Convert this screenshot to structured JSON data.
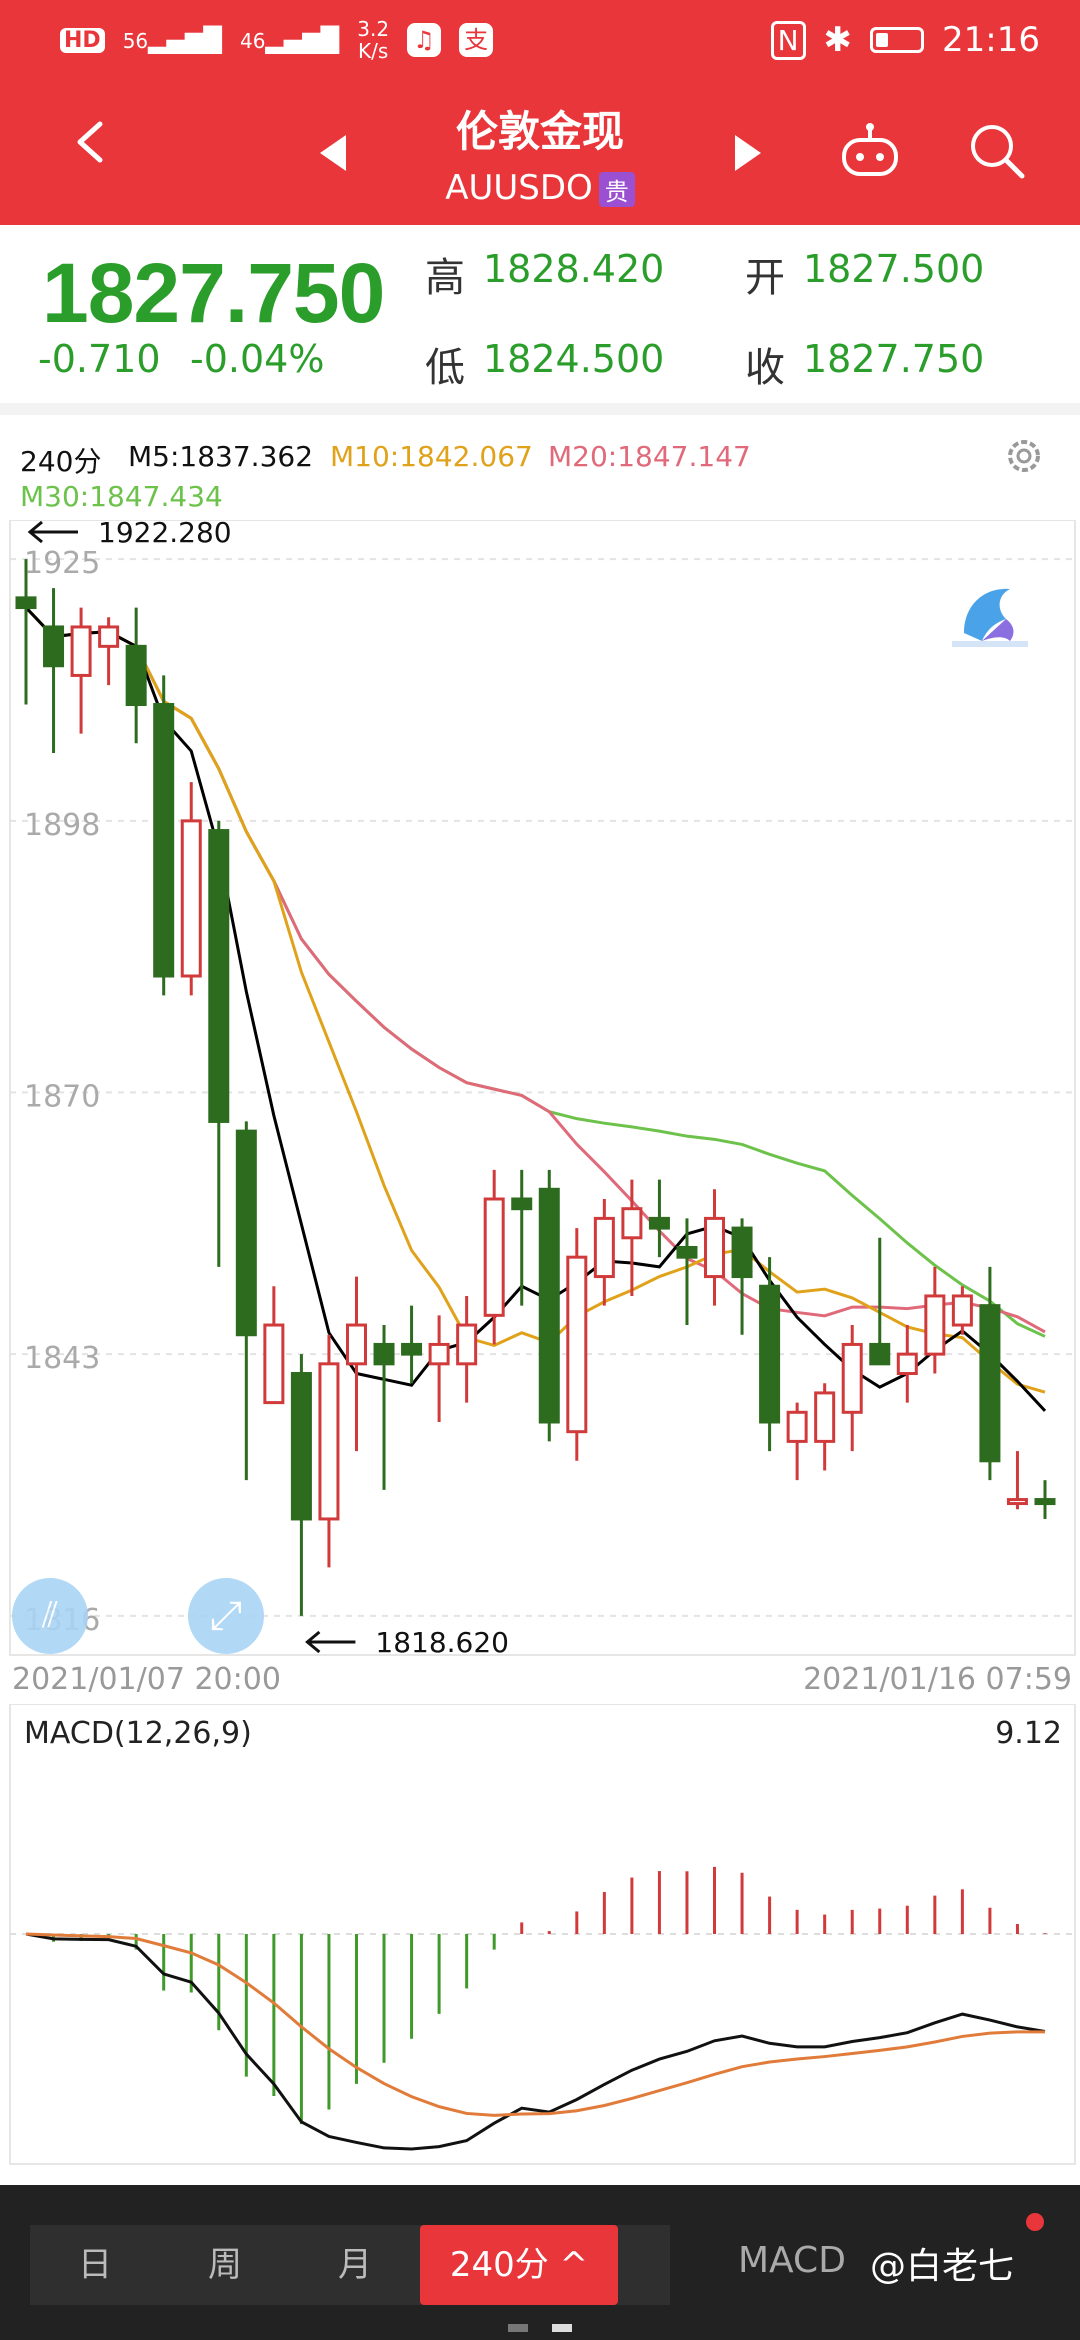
{
  "status_bar": {
    "hd_badge": "HD",
    "sim1": "56",
    "sim2": "46",
    "speed_value": "3.2",
    "speed_unit": "K/s",
    "time": "21:16"
  },
  "header": {
    "title": "伦敦金现",
    "code": "AUUSDO",
    "tag": "贵"
  },
  "quote": {
    "price": "1827.750",
    "change": "-0.710",
    "change_pct": "-0.04%",
    "high_label": "高",
    "high": "1828.420",
    "low_label": "低",
    "low": "1824.500",
    "open_label": "开",
    "open": "1827.500",
    "close_label": "收",
    "close": "1827.750"
  },
  "chart": {
    "period": "240分",
    "ma5": "M5:1837.362",
    "ma10": "M10:1842.067",
    "ma20": "M20:1847.147",
    "ma30": "M30:1847.434",
    "max_label": "1922.280",
    "min_label": "1818.620",
    "y_ticks": [
      "1925",
      "1898",
      "1870",
      "1843",
      "1816"
    ],
    "start_time": "2021/01/07 20:00",
    "end_time": "2021/01/16 07:59",
    "colors": {
      "ma5": "#000000",
      "ma10": "#e0a21a",
      "ma20": "#e0697a",
      "ma30": "#6cc24a",
      "up": "#d03a3a",
      "down": "#2d6b1e"
    }
  },
  "macd": {
    "label": "MACD(12,26,9)",
    "value": "9.12"
  },
  "bottom_bar": {
    "tabs": [
      "日",
      "周",
      "月",
      "240分 ^"
    ],
    "macd_button": "MACD",
    "watermark": "@白老七"
  },
  "chart_data": {
    "type": "candlestick",
    "candles": [
      {
        "o": 1921,
        "h": 1925,
        "l": 1910,
        "c": 1920
      },
      {
        "o": 1918,
        "h": 1922,
        "l": 1905,
        "c": 1914
      },
      {
        "o": 1913,
        "h": 1920,
        "l": 1907,
        "c": 1918
      },
      {
        "o": 1916,
        "h": 1919,
        "l": 1912,
        "c": 1918
      },
      {
        "o": 1916,
        "h": 1920,
        "l": 1906,
        "c": 1910
      },
      {
        "o": 1910,
        "h": 1913,
        "l": 1880,
        "c": 1882
      },
      {
        "o": 1882,
        "h": 1902,
        "l": 1880,
        "c": 1898
      },
      {
        "o": 1897,
        "h": 1898,
        "l": 1852,
        "c": 1867
      },
      {
        "o": 1866,
        "h": 1867,
        "l": 1830,
        "c": 1845
      },
      {
        "o": 1838,
        "h": 1850,
        "l": 1838,
        "c": 1846
      },
      {
        "o": 1841,
        "h": 1843,
        "l": 1816,
        "c": 1826
      },
      {
        "o": 1826,
        "h": 1845,
        "l": 1821,
        "c": 1842
      },
      {
        "o": 1842,
        "h": 1851,
        "l": 1833,
        "c": 1846
      },
      {
        "o": 1844,
        "h": 1846,
        "l": 1829,
        "c": 1842
      },
      {
        "o": 1844,
        "h": 1848,
        "l": 1840,
        "c": 1843
      },
      {
        "o": 1842,
        "h": 1847,
        "l": 1836,
        "c": 1844
      },
      {
        "o": 1842,
        "h": 1849,
        "l": 1838,
        "c": 1846
      },
      {
        "o": 1847,
        "h": 1862,
        "l": 1844,
        "c": 1859
      },
      {
        "o": 1859,
        "h": 1862,
        "l": 1848,
        "c": 1858
      },
      {
        "o": 1860,
        "h": 1862,
        "l": 1834,
        "c": 1836
      },
      {
        "o": 1835,
        "h": 1856,
        "l": 1832,
        "c": 1853
      },
      {
        "o": 1851,
        "h": 1859,
        "l": 1848,
        "c": 1857
      },
      {
        "o": 1855,
        "h": 1861,
        "l": 1849,
        "c": 1858
      },
      {
        "o": 1857,
        "h": 1861,
        "l": 1853,
        "c": 1856
      },
      {
        "o": 1854,
        "h": 1857,
        "l": 1846,
        "c": 1853
      },
      {
        "o": 1851,
        "h": 1860,
        "l": 1848,
        "c": 1857
      },
      {
        "o": 1856,
        "h": 1857,
        "l": 1845,
        "c": 1851
      },
      {
        "o": 1850,
        "h": 1853,
        "l": 1833,
        "c": 1836
      },
      {
        "o": 1834,
        "h": 1838,
        "l": 1830,
        "c": 1837
      },
      {
        "o": 1834,
        "h": 1840,
        "l": 1831,
        "c": 1839
      },
      {
        "o": 1837,
        "h": 1846,
        "l": 1833,
        "c": 1844
      },
      {
        "o": 1844,
        "h": 1855,
        "l": 1843,
        "c": 1842
      },
      {
        "o": 1841,
        "h": 1846,
        "l": 1838,
        "c": 1843
      },
      {
        "o": 1843,
        "h": 1852,
        "l": 1841,
        "c": 1849
      },
      {
        "o": 1846,
        "h": 1850,
        "l": 1845,
        "c": 1849
      },
      {
        "o": 1848,
        "h": 1852,
        "l": 1830,
        "c": 1832
      },
      {
        "o": 1828,
        "h": 1833,
        "l": 1827,
        "c": 1828
      },
      {
        "o": 1828,
        "h": 1830,
        "l": 1826,
        "c": 1827.75
      }
    ],
    "ylim": [
      1813,
      1928
    ]
  }
}
